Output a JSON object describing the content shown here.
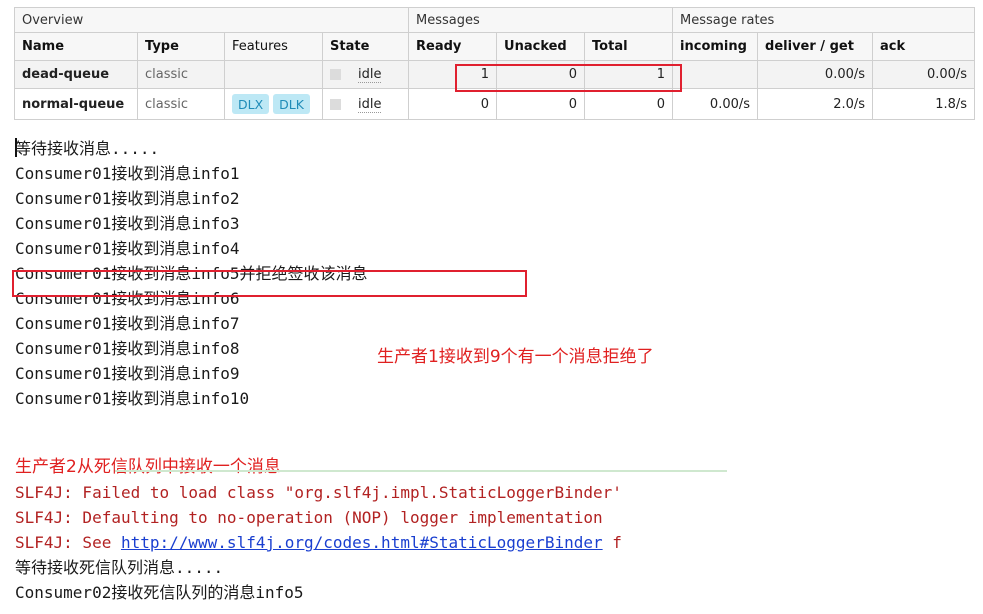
{
  "table": {
    "groups": {
      "overview": "Overview",
      "messages": "Messages",
      "rates": "Message rates"
    },
    "headers": {
      "name": "Name",
      "type": "Type",
      "features": "Features",
      "state": "State",
      "ready": "Ready",
      "unacked": "Unacked",
      "total": "Total",
      "incoming": "incoming",
      "deliver_get": "deliver / get",
      "ack": "ack"
    },
    "rows": [
      {
        "name": "dead-queue",
        "type": "classic",
        "features": [],
        "state": "idle",
        "ready": "1",
        "unacked": "0",
        "total": "1",
        "incoming": "",
        "deliver_get": "0.00/s",
        "ack": "0.00/s"
      },
      {
        "name": "normal-queue",
        "type": "classic",
        "features": [
          "DLX",
          "DLK"
        ],
        "state": "idle",
        "ready": "0",
        "unacked": "0",
        "total": "0",
        "incoming": "0.00/s",
        "deliver_get": "2.0/s",
        "ack": "1.8/s"
      }
    ]
  },
  "console1": [
    "等待接收消息.....",
    "Consumer01接收到消息info1",
    "Consumer01接收到消息info2",
    "Consumer01接收到消息info3",
    "Consumer01接收到消息info4",
    "Consumer01接收到消息info5并拒绝签收该消息",
    "Consumer01接收到消息info6",
    "Consumer01接收到消息info7",
    "Consumer01接收到消息info8",
    "Consumer01接收到消息info9",
    "Consumer01接收到消息info10"
  ],
  "annotations": {
    "producer1": "生产者1接收到9个有一个消息拒绝了",
    "producer2": "生产者2从死信队列中接收一个消息"
  },
  "console2": {
    "slf4j_line1": "SLF4J: Failed to load class \"org.slf4j.impl.StaticLoggerBinder'",
    "slf4j_line2": "SLF4J: Defaulting to no-operation (NOP) logger implementation",
    "slf4j_line3_prefix": "SLF4J: See ",
    "slf4j_line3_link": "http://www.slf4j.org/codes.html#StaticLoggerBinder",
    "slf4j_line3_suffix": " f",
    "wait_line": "等待接收死信队列消息.....",
    "received_line": "Consumer02接收死信队列的消息info5"
  },
  "colors": {
    "annotation": "#e02020",
    "highlight_box": "#e0202f",
    "tag_bg": "#bde8f5",
    "tag_text": "#1f8cb8",
    "error_text": "#b22222",
    "link": "#1a3fd0"
  }
}
